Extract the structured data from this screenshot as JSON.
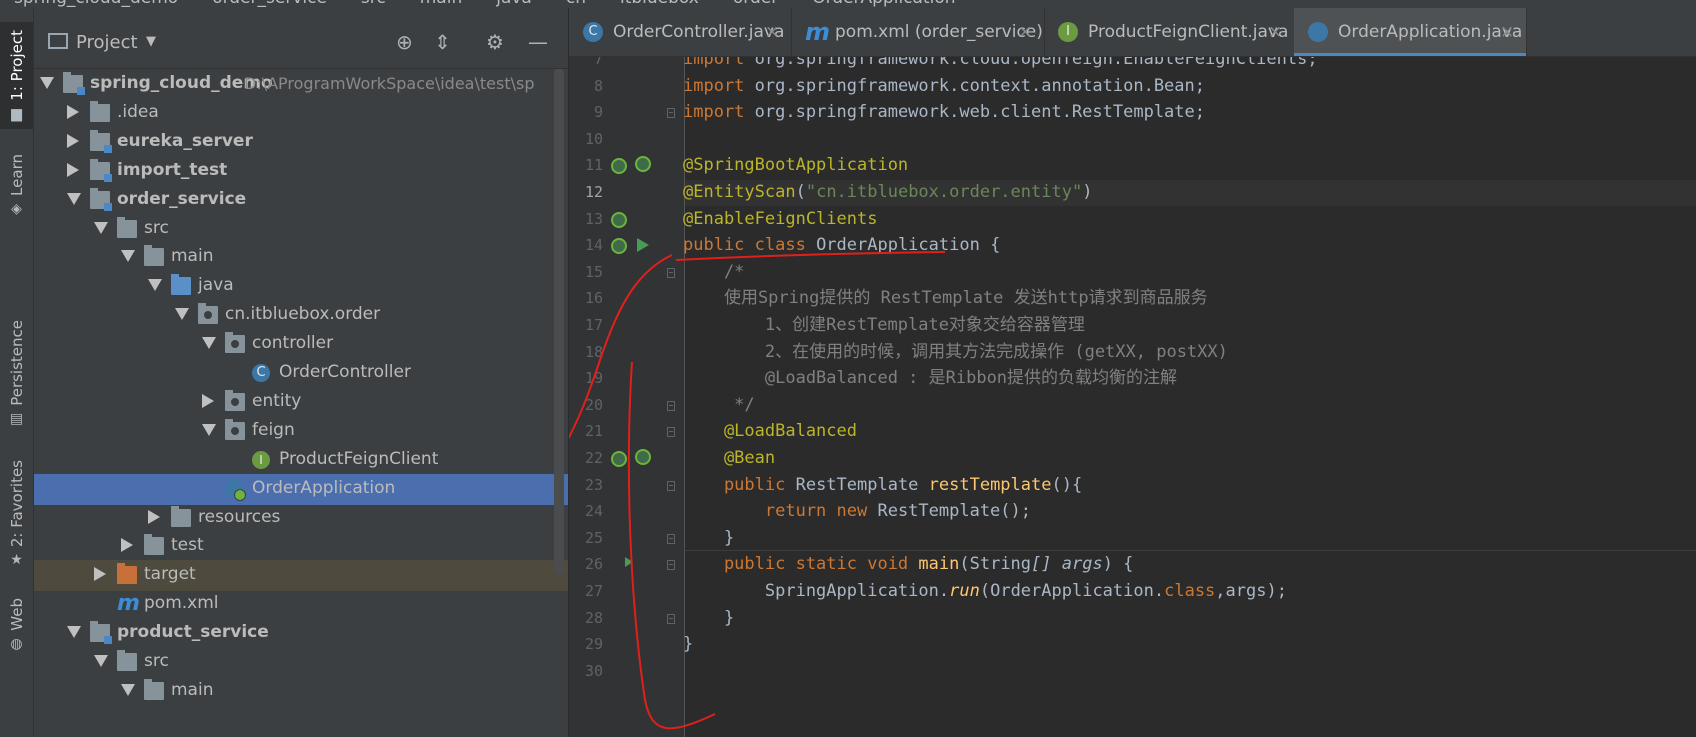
{
  "breadcrumbs": [
    "spring_cloud_demo",
    "order_service",
    "src",
    "main",
    "java",
    "cn",
    "itbluebox",
    "order",
    "OrderApplication"
  ],
  "left_tools": [
    {
      "label": "1: Project",
      "icon": "folder-icon"
    },
    {
      "label": "Learn",
      "icon": "learn-icon"
    },
    {
      "label": "Persistence",
      "icon": "persistence-icon"
    },
    {
      "label": "2: Favorites",
      "icon": "star-icon"
    },
    {
      "label": "Web",
      "icon": "web-icon"
    }
  ],
  "project": {
    "title": "Project",
    "tree": [
      {
        "label": "spring_cloud_demo",
        "path": "D:\\AProgramWorkSpace\\idea\\test\\sp",
        "depth": 0,
        "expand": "down",
        "icon": "module"
      },
      {
        "label": ".idea",
        "depth": 1,
        "expand": "right",
        "icon": "folder"
      },
      {
        "label": "eureka_server",
        "depth": 1,
        "expand": "right",
        "icon": "module"
      },
      {
        "label": "import_test",
        "depth": 1,
        "expand": "right",
        "icon": "module"
      },
      {
        "label": "order_service",
        "depth": 1,
        "expand": "down",
        "icon": "module"
      },
      {
        "label": "src",
        "depth": 2,
        "expand": "down",
        "icon": "folder"
      },
      {
        "label": "main",
        "depth": 3,
        "expand": "down",
        "icon": "folder"
      },
      {
        "label": "java",
        "depth": 4,
        "expand": "down",
        "icon": "folder-blue"
      },
      {
        "label": "cn.itbluebox.order",
        "depth": 5,
        "expand": "down",
        "icon": "pkg"
      },
      {
        "label": "controller",
        "depth": 6,
        "expand": "down",
        "icon": "pkg"
      },
      {
        "label": "OrderController",
        "depth": 7,
        "expand": "none",
        "icon": "cls"
      },
      {
        "label": "entity",
        "depth": 6,
        "expand": "right",
        "icon": "pkg"
      },
      {
        "label": "feign",
        "depth": 6,
        "expand": "down",
        "icon": "pkg"
      },
      {
        "label": "ProductFeignClient",
        "depth": 7,
        "expand": "none",
        "icon": "intf"
      },
      {
        "label": "OrderApplication",
        "depth": 6,
        "expand": "none",
        "icon": "boot"
      },
      {
        "label": "resources",
        "depth": 4,
        "expand": "right",
        "icon": "folder"
      },
      {
        "label": "test",
        "depth": 3,
        "expand": "right",
        "icon": "folder"
      },
      {
        "label": "target",
        "depth": 2,
        "expand": "right",
        "icon": "folder-orange"
      },
      {
        "label": "pom.xml",
        "depth": 2,
        "expand": "none",
        "icon": "maven"
      },
      {
        "label": "product_service",
        "depth": 1,
        "expand": "down",
        "icon": "module"
      },
      {
        "label": "src",
        "depth": 2,
        "expand": "down",
        "icon": "folder"
      },
      {
        "label": "main",
        "depth": 3,
        "expand": "down",
        "icon": "folder"
      }
    ]
  },
  "tabs": [
    {
      "label": "OrderController.java",
      "icon": "c"
    },
    {
      "label": "pom.xml (order_service)",
      "icon": "m"
    },
    {
      "label": "ProductFeignClient.java",
      "icon": "i"
    },
    {
      "label": "OrderApplication.java",
      "icon": "b",
      "active": true
    }
  ],
  "editor": {
    "current_line": 12,
    "lines": [
      {
        "n": 7,
        "tokens": [
          [
            "kw",
            "import "
          ],
          [
            "pkg",
            "org.springframework.cloud.openfeign.EnableFeignClients"
          ],
          [
            "plain",
            ";"
          ]
        ]
      },
      {
        "n": 8,
        "tokens": [
          [
            "kw",
            "import "
          ],
          [
            "pkg",
            "org.springframework.context.annotation.Bean"
          ],
          [
            "plain",
            ";"
          ]
        ]
      },
      {
        "n": 9,
        "tokens": [
          [
            "kw",
            "import "
          ],
          [
            "pkg",
            "org.springframework.web.client.RestTemplate"
          ],
          [
            "plain",
            ";"
          ]
        ]
      },
      {
        "n": 10,
        "tokens": []
      },
      {
        "n": 11,
        "tokens": [
          [
            "ann",
            "@SpringBootApplication"
          ]
        ]
      },
      {
        "n": 12,
        "tokens": [
          [
            "ann",
            "@EntityScan"
          ],
          [
            "plain",
            "("
          ],
          [
            "str",
            "\"cn.itbluebox.order.entity\""
          ],
          [
            "plain",
            ")"
          ]
        ]
      },
      {
        "n": 13,
        "tokens": [
          [
            "ann",
            "@EnableFeignClients"
          ]
        ]
      },
      {
        "n": 14,
        "tokens": [
          [
            "kw",
            "public class "
          ],
          [
            "cls",
            "OrderApplication "
          ],
          [
            "plain",
            "{"
          ]
        ]
      },
      {
        "n": 15,
        "tokens": [
          [
            "cmt",
            "    /*"
          ]
        ]
      },
      {
        "n": 16,
        "tokens": [
          [
            "cmt",
            "    使用Spring提供的 RestTemplate 发送http请求到商品服务"
          ]
        ]
      },
      {
        "n": 17,
        "tokens": [
          [
            "cmt",
            "        1、创建RestTemplate对象交给容器管理"
          ]
        ]
      },
      {
        "n": 18,
        "tokens": [
          [
            "cmt",
            "        2、在使用的时候，调用其方法完成操作 (getXX, postXX)"
          ]
        ]
      },
      {
        "n": 19,
        "tokens": [
          [
            "cmt",
            "        @LoadBalanced : 是Ribbon提供的负载均衡的注解"
          ]
        ]
      },
      {
        "n": 20,
        "tokens": [
          [
            "cmt",
            "     */"
          ]
        ]
      },
      {
        "n": 21,
        "tokens": [
          [
            "ann",
            "    @LoadBalanced"
          ]
        ]
      },
      {
        "n": 22,
        "tokens": [
          [
            "ann",
            "    @Bean"
          ]
        ]
      },
      {
        "n": 23,
        "tokens": [
          [
            "kw",
            "    public "
          ],
          [
            "cls",
            "RestTemplate "
          ],
          [
            "mth",
            "restTemplate"
          ],
          [
            "plain",
            "(){"
          ]
        ]
      },
      {
        "n": 24,
        "tokens": [
          [
            "kw",
            "        return new "
          ],
          [
            "cls",
            "RestTemplate"
          ],
          [
            "plain",
            "();"
          ]
        ]
      },
      {
        "n": 25,
        "tokens": [
          [
            "plain",
            "    }"
          ]
        ]
      },
      {
        "n": 26,
        "tokens": [
          [
            "kw",
            "    public static void "
          ],
          [
            "mth",
            "main"
          ],
          [
            "plain",
            "("
          ],
          [
            "cls",
            "String"
          ],
          [
            "plain",
            "[] "
          ],
          [
            "par",
            "args"
          ],
          [
            "plain",
            ") {"
          ]
        ]
      },
      {
        "n": 27,
        "tokens": [
          [
            "cls",
            "        SpringApplication"
          ],
          [
            "plain",
            "."
          ],
          [
            "mth",
            "run"
          ],
          [
            "plain",
            "("
          ],
          [
            "cls",
            "OrderApplication"
          ],
          [
            "plain",
            "."
          ],
          [
            "kw",
            "class"
          ],
          [
            "plain",
            ","
          ],
          [
            "par",
            "args"
          ],
          [
            "plain",
            ");"
          ]
        ]
      },
      {
        "n": 28,
        "tokens": [
          [
            "plain",
            "    }"
          ]
        ]
      },
      {
        "n": 29,
        "tokens": [
          [
            "plain",
            "}"
          ]
        ]
      },
      {
        "n": 30,
        "tokens": []
      }
    ]
  },
  "colors": {
    "keyword": "#cc7832",
    "annotation": "#bbb529",
    "string": "#6a8759",
    "comment": "#808080",
    "method": "#ffc66d",
    "selection": "#4b6eaf",
    "annotation_stroke": "#e0201b"
  }
}
